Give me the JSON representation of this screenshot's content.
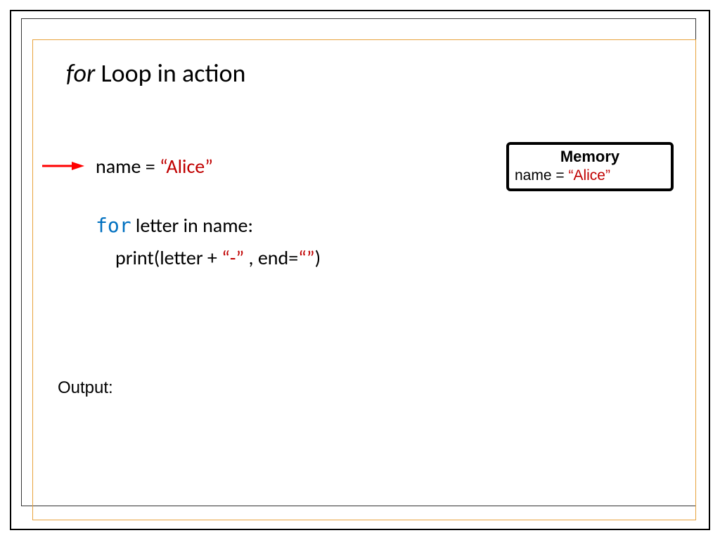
{
  "title": {
    "keyword": "for",
    "rest": " Loop in action"
  },
  "code": {
    "line1": {
      "left": "name = ",
      "string": "“Alice”"
    },
    "line2": {
      "keyword": "for",
      "rest": " letter in name:"
    },
    "line3": {
      "a": "print(letter + ",
      "dash": "“-”",
      "b": " , end=",
      "empty": "“”",
      "c": ")"
    }
  },
  "memory": {
    "title": "Memory",
    "var": "name = ",
    "value": "“Alice”"
  },
  "output": {
    "label": "Output:"
  },
  "colors": {
    "red": "#c00000",
    "blue": "#0070c0",
    "orange": "#e8a33d"
  }
}
